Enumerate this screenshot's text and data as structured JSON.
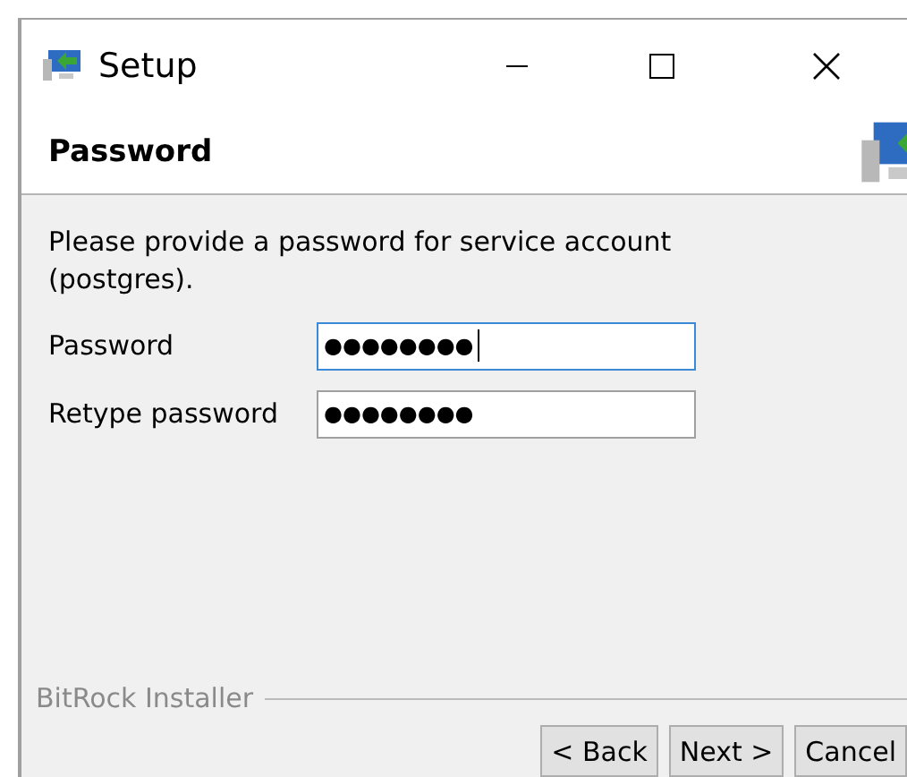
{
  "window": {
    "title": "Setup"
  },
  "header": {
    "title": "Password"
  },
  "intro": "Please provide a password for service account (postgres).",
  "fields": [
    {
      "label": "Password",
      "value": "●●●●●●●●",
      "focused": true
    },
    {
      "label": "Retype password",
      "value": "●●●●●●●●",
      "focused": false
    }
  ],
  "footer": {
    "brand": "BitRock Installer"
  },
  "buttons": [
    "< Back",
    "Next >",
    "Cancel"
  ]
}
